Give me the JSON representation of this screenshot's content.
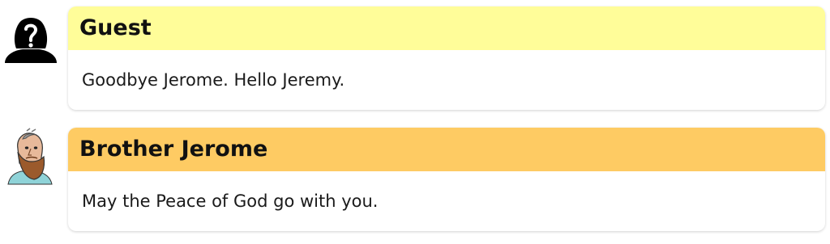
{
  "messages": [
    {
      "author": "Guest",
      "text": "Goodbye Jerome. Hello Jeremy.",
      "avatar_icon": "unknown-person-silhouette-icon",
      "header_color": "#fffd99"
    },
    {
      "author": "Brother Jerome",
      "text": "May the Peace of God go with you.",
      "avatar_icon": "bearded-monk-portrait-icon",
      "header_color": "#fecb63"
    }
  ]
}
